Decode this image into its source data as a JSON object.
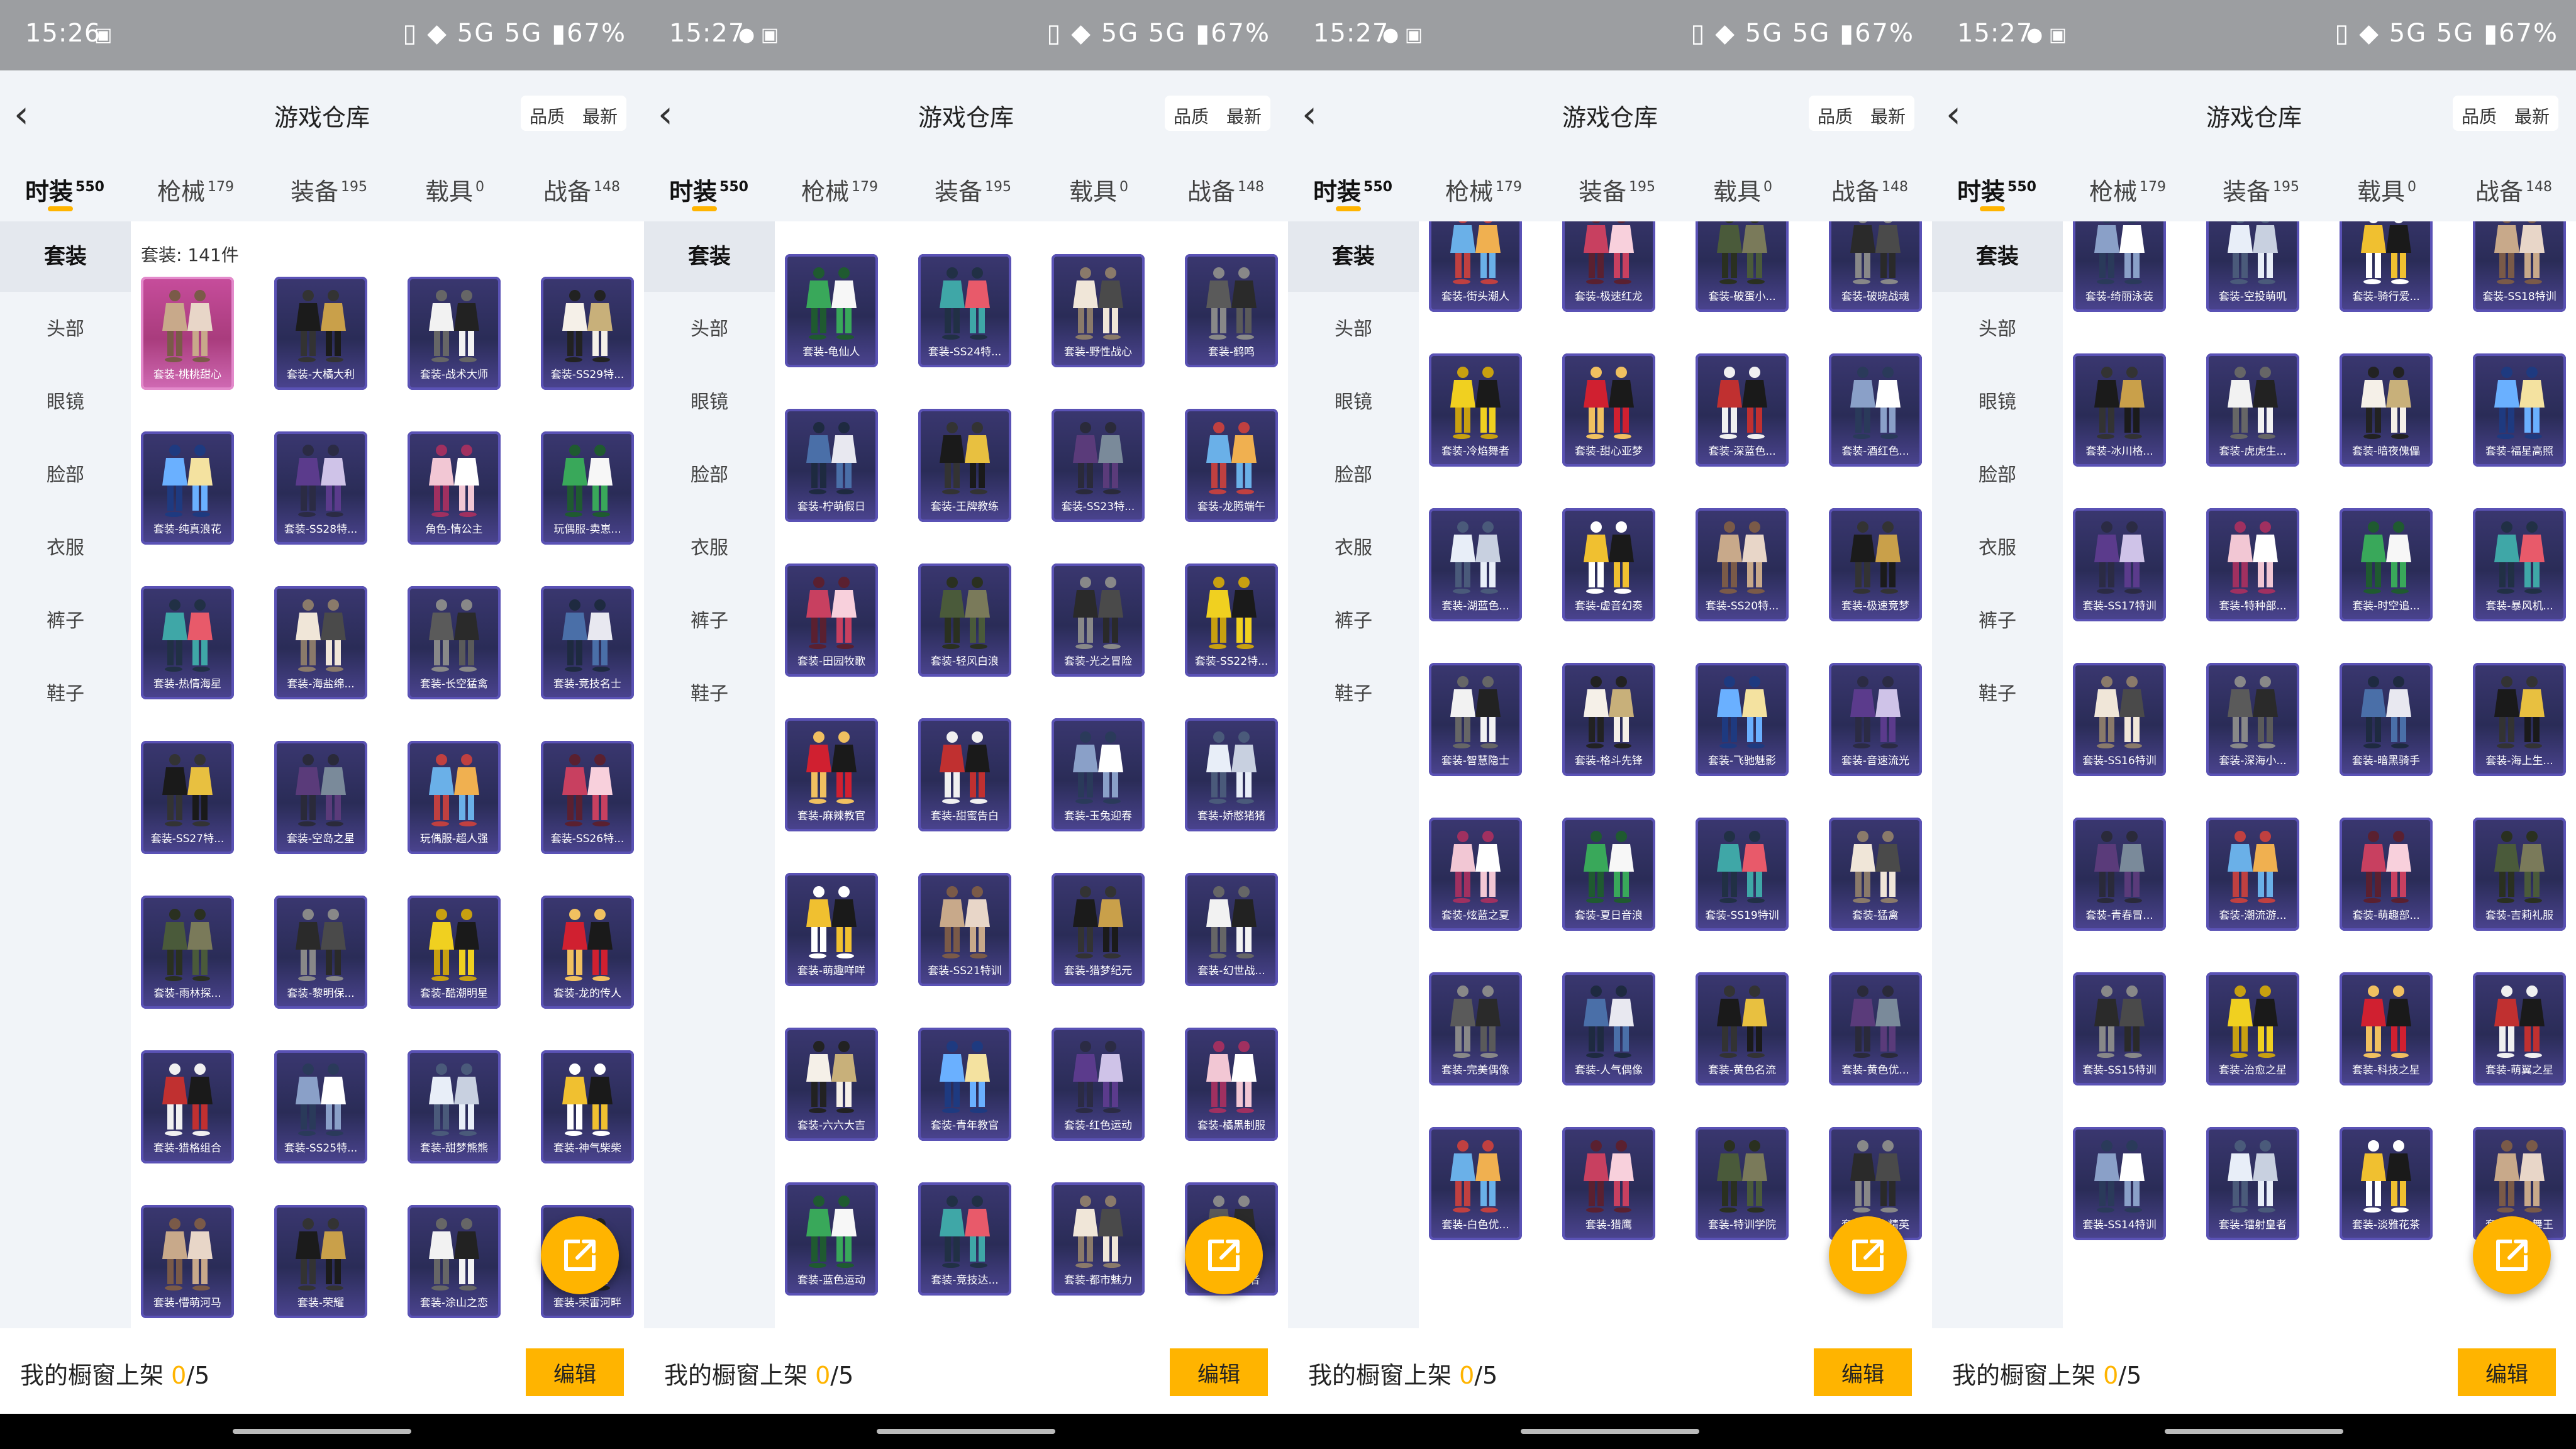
{
  "status_bars": [
    {
      "time": "15:26",
      "apps": "▣",
      "right": "▯ ◆ 5G 5G ▮67%"
    },
    {
      "time": "15:27",
      "apps": "● ▣",
      "right": "▯ ◆ 5G 5G ▮67%"
    },
    {
      "time": "15:27",
      "apps": "● ▣",
      "right": "▯ ◆ 5G 5G ▮67%"
    },
    {
      "time": "15:27",
      "apps": "● ▣",
      "right": "▯ ◆ 5G 5G ▮67%"
    }
  ],
  "header": {
    "back_icon": "‹",
    "title": "游戏仓库",
    "sort": [
      "品质",
      "最新"
    ]
  },
  "tabs": [
    {
      "label": "时装",
      "count": "550"
    },
    {
      "label": "枪械",
      "count": "179"
    },
    {
      "label": "装备",
      "count": "195"
    },
    {
      "label": "载具",
      "count": "0"
    },
    {
      "label": "战备",
      "count": "148"
    }
  ],
  "sidebar": [
    "套装",
    "头部",
    "眼镜",
    "脸部",
    "衣服",
    "裤子",
    "鞋子"
  ],
  "grid_count": "套装: 141件",
  "screens": [
    [
      "套装-桃桃甜心",
      "套装-大橘大利",
      "套装-战术大师",
      "套装-SS29特...",
      "套装-纯真浪花",
      "套装-SS28特...",
      "角色-情公主",
      "玩偶服-卖崽...",
      "套装-热情海星",
      "套装-海盐绵...",
      "套装-长空猛禽",
      "套装-竞技名士",
      "套装-SS27特...",
      "套装-空岛之星",
      "玩偶服-超人强",
      "套装-SS26特...",
      "套装-雨林探...",
      "套装-黎明保...",
      "套装-酷潮明星",
      "套装-龙的传人",
      "套装-猎格组合",
      "套装-SS25特...",
      "套装-甜梦熊熊",
      "套装-神气柴柴",
      "套装-懵萌河马",
      "套装-荣耀",
      "套装-涂山之恋",
      "套装-荣雷河畔"
    ],
    [
      "套装-龟仙人",
      "套装-SS24特...",
      "套装-野性战心",
      "套装-鹤鸣",
      "套装-柠萌假日",
      "套装-王牌教练",
      "套装-SS23特...",
      "套装-龙腾端午",
      "套装-田园牧歌",
      "套装-轻风白浪",
      "套装-光之冒险",
      "套装-SS22特...",
      "套装-麻辣教官",
      "套装-甜蜜告白",
      "套装-玉兔迎春",
      "套装-娇憨猪猪",
      "套装-萌趣咩咩",
      "套装-SS21特训",
      "套装-猎梦纪元",
      "套装-幻世战...",
      "套装-六六大吉",
      "套装-青年教官",
      "套装-红色运动",
      "套装-橘黑制服",
      "套装-蓝色运动",
      "套装-竞技达...",
      "套装-都市魅力",
      "套装-守护者"
    ],
    [
      "套装-街头潮人",
      "套装-极速红龙",
      "套装-破蛋小...",
      "套装-破晓战魂",
      "套装-冷焰舞者",
      "套装-甜心亚梦",
      "套装-深蓝色...",
      "套装-酒红色...",
      "套装-湖蓝色...",
      "套装-虚音幻奏",
      "套装-SS20特...",
      "套装-极速竞梦",
      "套装-智慧隐士",
      "套装-格斗先锋",
      "套装-飞驰魅影",
      "套装-音速流光",
      "套装-炫蓝之夏",
      "套装-夏日音浪",
      "套装-SS19特训",
      "套装-猛禽",
      "套装-完美偶像",
      "套装-人气偶像",
      "套装-黄色名流",
      "套装-黄色优...",
      "套装-白色优...",
      "套装-猎鹰",
      "套装-特训学院",
      "套装-雪山精英"
    ],
    [
      "套装-绮丽泳装",
      "套装-空投萌叽",
      "套装-骑行爱...",
      "套装-SS18特训",
      "套装-冰川格...",
      "套装-虎虎生...",
      "套装-暗夜傀儡",
      "套装-福星高照",
      "套装-SS17特训",
      "套装-特种部...",
      "套装-时空追...",
      "套装-暴风机...",
      "套装-SS16特训",
      "套装-深海小...",
      "套装-暗黑骑手",
      "套装-海上生...",
      "套装-青春冒...",
      "套装-潮流游...",
      "套装-萌趣部...",
      "套装-吉莉礼服",
      "套装-SS15特训",
      "套装-治愈之星",
      "套装-科技之星",
      "套装-萌翼之星",
      "套装-SS14特训",
      "套装-镭射皇者",
      "套装-淡雅花茶",
      "套装-银白舞王"
    ]
  ],
  "bottom": {
    "label": "我的橱窗上架 ",
    "current": "0",
    "total": "/5",
    "edit": "编辑"
  },
  "icons": {
    "fab": "share-external-icon",
    "back": "back-chevron-icon"
  },
  "colors": {
    "accent": "#ffb400",
    "card": "#2f2d62",
    "card_selected": "#c74d9c"
  }
}
